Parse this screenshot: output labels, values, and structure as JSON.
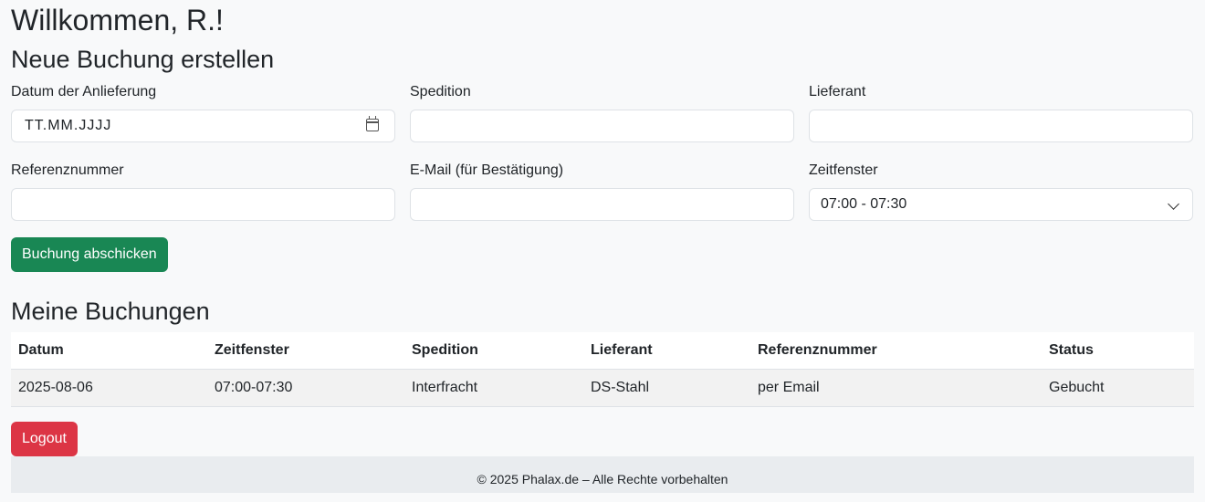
{
  "header": {
    "welcome": "Willkommen, R.!"
  },
  "form": {
    "title": "Neue Buchung erstellen",
    "date": {
      "label": "Datum der Anlieferung",
      "placeholder": "TT.MM.JJJJ"
    },
    "spedition": {
      "label": "Spedition",
      "value": ""
    },
    "lieferant": {
      "label": "Lieferant",
      "value": ""
    },
    "referenz": {
      "label": "Referenznummer",
      "value": ""
    },
    "email": {
      "label": "E-Mail (für Bestätigung)",
      "value": ""
    },
    "zeitfenster": {
      "label": "Zeitfenster",
      "selected": "07:00 - 07:30"
    },
    "submit_label": "Buchung abschicken"
  },
  "bookings": {
    "title": "Meine Buchungen",
    "columns": [
      "Datum",
      "Zeitfenster",
      "Spedition",
      "Lieferant",
      "Referenznummer",
      "Status"
    ],
    "rows": [
      [
        "2025-08-06",
        "07:00-07:30",
        "Interfracht",
        "DS-Stahl",
        "per Email",
        "Gebucht"
      ]
    ]
  },
  "logout_label": "Logout",
  "footer": {
    "text": "© 2025 Phalax.de – Alle Rechte vorbehalten"
  }
}
